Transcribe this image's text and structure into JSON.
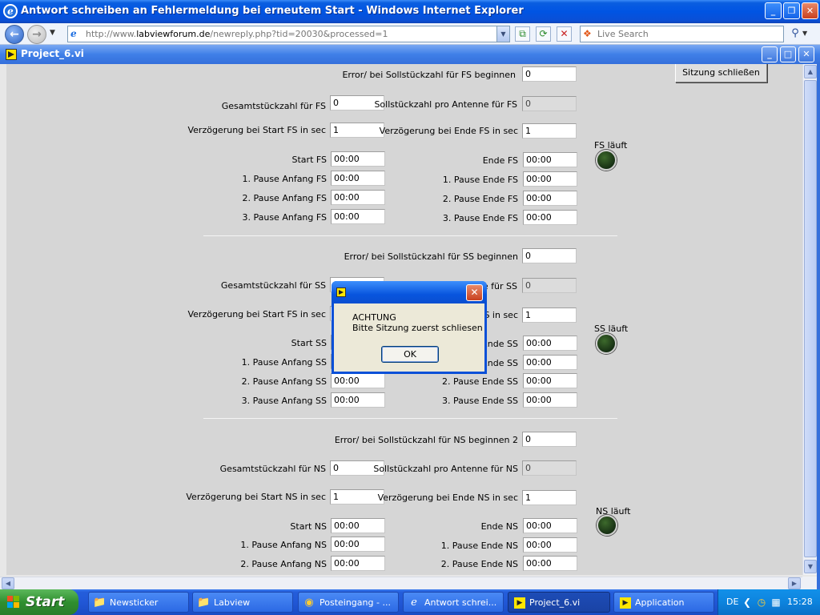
{
  "browser": {
    "title": "Antwort schreiben an Fehlermeldung bei erneutem Start - Windows Internet Explorer",
    "url_prefix": "http://www.",
    "url_domain": "labviewforum.de",
    "url_rest": "/newreply.php?tid=20030&processed=1",
    "search_placeholder": "Live Search"
  },
  "vi_window": {
    "title": "Project_6.vi",
    "close_session_label": "Sitzung schließen"
  },
  "fs": {
    "error_label": "Error/ bei Sollstückzahl für FS beginnen",
    "error_value": "0",
    "total_label": "Gesamtstückzahl für FS",
    "total_value": "0",
    "per_antenna_label": "Sollstückzahl pro Antenne für FS",
    "per_antenna_value": "0",
    "delay_start_label": "Verzögerung bei Start FS in sec",
    "delay_start_value": "1",
    "delay_end_label": "Verzögerung bei Ende FS in sec",
    "delay_end_value": "1",
    "led_label": "FS läuft",
    "start_label": "Start FS",
    "start_value": "00:00",
    "end_label": "Ende FS",
    "end_value": "00:00",
    "p1s_label": "1. Pause Anfang FS",
    "p1s_value": "00:00",
    "p1e_label": "1. Pause Ende FS",
    "p1e_value": "00:00",
    "p2s_label": "2. Pause Anfang FS",
    "p2s_value": "00:00",
    "p2e_label": "2. Pause Ende FS",
    "p2e_value": "00:00",
    "p3s_label": "3. Pause Anfang FS",
    "p3s_value": "00:00",
    "p3e_label": "3. Pause Ende FS",
    "p3e_value": "00:00"
  },
  "ss": {
    "error_label": "Error/ bei Sollstückzahl für SS beginnen",
    "error_value": "0",
    "total_label": "Gesamtstückzahl für SS",
    "per_antenna_label": "e für SS",
    "per_antenna_value": "0",
    "delay_start_label": "Verzögerung bei Start FS in sec",
    "delay_end_label": "S in sec",
    "delay_end_value": "1",
    "led_label": "SS läuft",
    "start_label": "Start SS",
    "end_label": "Ende SS",
    "end_value": "00:00",
    "p1s_label": "1. Pause Anfang SS",
    "p1e_label": "Ende SS",
    "p1e_value": "00:00",
    "p2s_label": "2. Pause Anfang SS",
    "p2s_value": "00:00",
    "p2e_label": "2. Pause Ende SS",
    "p2e_value": "00:00",
    "p3s_label": "3. Pause Anfang SS",
    "p3s_value": "00:00",
    "p3e_label": "3. Pause Ende SS",
    "p3e_value": "00:00"
  },
  "ns": {
    "error_label": "Error/ bei Sollstückzahl für NS beginnen 2",
    "error_value": "0",
    "total_label": "Gesamtstückzahl für NS",
    "total_value": "0",
    "per_antenna_label": "Sollstückzahl pro Antenne für NS",
    "per_antenna_value": "0",
    "delay_start_label": "Verzögerung bei Start NS in sec",
    "delay_start_value": "1",
    "delay_end_label": "Verzögerung bei Ende NS in sec",
    "delay_end_value": "1",
    "led_label": "NS läuft",
    "start_label": "Start NS",
    "start_value": "00:00",
    "end_label": "Ende NS",
    "end_value": "00:00",
    "p1s_label": "1. Pause Anfang NS",
    "p1s_value": "00:00",
    "p1e_label": "1. Pause Ende NS",
    "p1e_value": "00:00",
    "p2s_label": "2. Pause Anfang NS",
    "p2s_value": "00:00",
    "p2e_label": "2. Pause Ende NS",
    "p2e_value": "00:00"
  },
  "dialog": {
    "line1": "ACHTUNG",
    "line2": "Bitte Sitzung zuerst schliesen",
    "ok_label": "OK"
  },
  "taskbar": {
    "start_label": "Start",
    "tasks": [
      {
        "label": "Newsticker",
        "icon": "folder-icon"
      },
      {
        "label": "Labview",
        "icon": "folder-icon"
      },
      {
        "label": "Posteingang - ...",
        "icon": "mail-icon"
      },
      {
        "label": "Antwort schrei...",
        "icon": "ie-icon"
      },
      {
        "label": "Project_6.vi",
        "icon": "labview-icon"
      },
      {
        "label": "Application",
        "icon": "labview-icon"
      }
    ],
    "lang": "DE",
    "clock": "15:28"
  },
  "colors": {
    "xp_blue": "#0054e3",
    "panel_bg": "#d6d6d6",
    "led_off": "#173014",
    "start_green": "#2f8f2f"
  }
}
